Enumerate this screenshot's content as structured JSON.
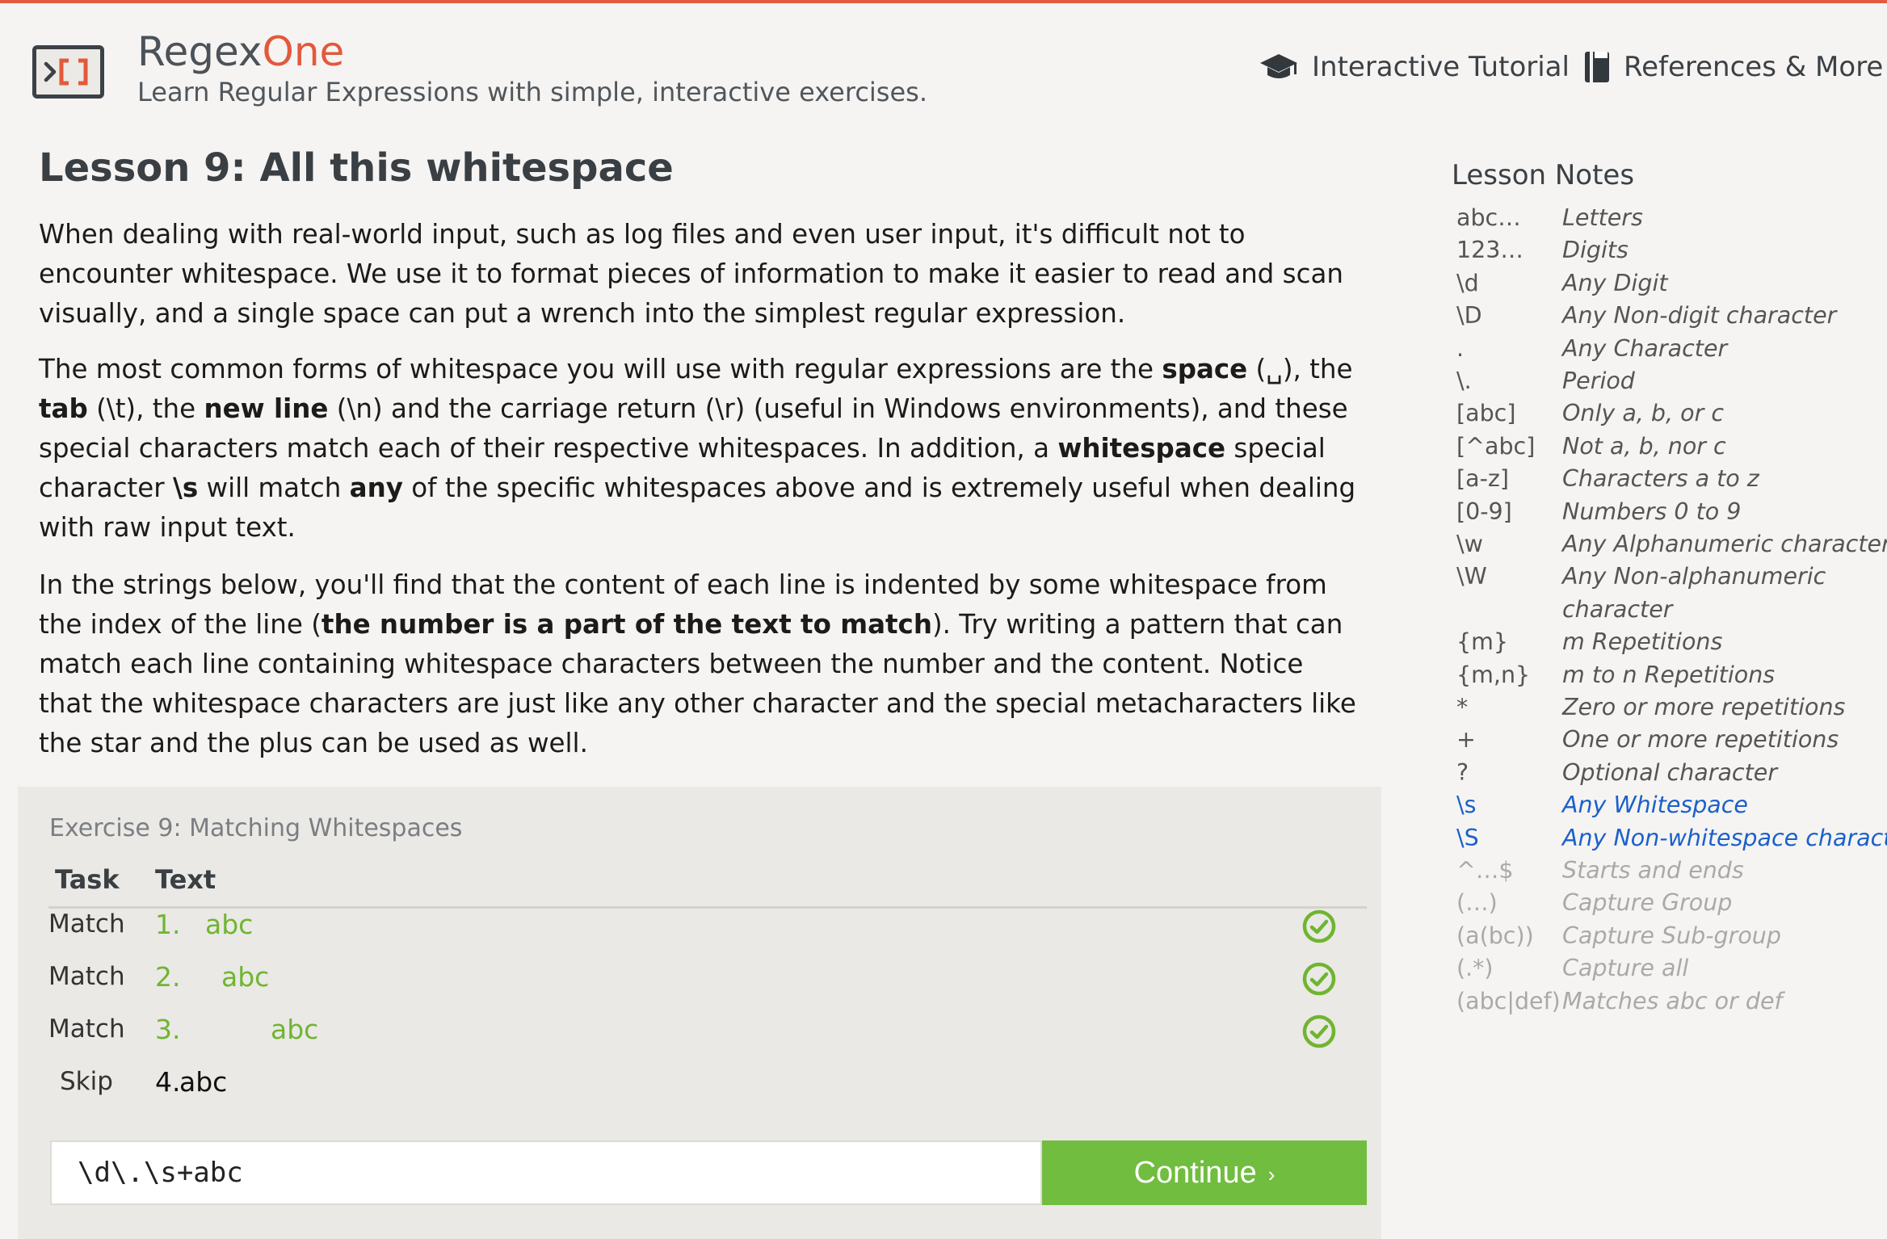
{
  "brand": {
    "name_start": "Regex",
    "name_accent": "One",
    "tagline": "Learn Regular Expressions with simple, interactive exercises."
  },
  "nav": [
    {
      "label": "Interactive Tutorial",
      "icon": "graduation-cap-icon"
    },
    {
      "label": "References & More",
      "icon": "book-icon"
    }
  ],
  "lesson": {
    "title": "Lesson 9: All this whitespace",
    "p1": "When dealing with real-world input, such as log files and even user input, it's difficult not to encounter whitespace. We use it to format pieces of information to make it easier to read and scan visually, and a single space can put a wrench into the simplest regular expression.",
    "p2": {
      "t1": "The most common forms of whitespace you will use with regular expressions are the ",
      "b1": "space",
      "t2": " (␣), the ",
      "b2": "tab",
      "t3": " (\\t), the ",
      "b3": "new line",
      "t4": " (\\n) and the carriage return (\\r) (useful in Windows environments), and these special characters match each of their respective whitespaces. In addition, a ",
      "b4": "whitespace",
      "t5": " special character ",
      "b5": "\\s",
      "t6": " will match ",
      "b6": "any",
      "t7": " of the specific whitespaces above and is extremely useful when dealing with raw input text."
    },
    "p3": {
      "t1": "In the strings below, you'll find that the content of each line is indented by some whitespace from the index of the line (",
      "b1": "the number is a part of the text to match",
      "t2": "). Try writing a pattern that can match each line containing whitespace characters between the number and the content. Notice that the whitespace characters are just like any other character and the special metacharacters like the star and the plus can be used as well."
    }
  },
  "exercise": {
    "title": "Exercise 9: Matching Whitespaces",
    "header_task": "Task",
    "header_text": "Text",
    "rows": [
      {
        "task": "Match",
        "num": "1.",
        "text": "abc",
        "matched": true
      },
      {
        "task": "Match",
        "num": "2.",
        "text": "abc",
        "matched": true
      },
      {
        "task": "Match",
        "num": "3.",
        "text": "abc",
        "matched": true
      },
      {
        "task": "Skip",
        "num": "4.",
        "text": "abc",
        "matched": false
      }
    ],
    "input_value": "\\d\\.\\s+abc",
    "continue_label": "Continue",
    "continue_chevron": "›"
  },
  "notes": {
    "title": "Lesson Notes",
    "items": [
      {
        "sym": "abc…",
        "desc": "Letters"
      },
      {
        "sym": "123…",
        "desc": "Digits"
      },
      {
        "sym": "\\d",
        "desc": "Any Digit"
      },
      {
        "sym": "\\D",
        "desc": "Any Non-digit character"
      },
      {
        "sym": ".",
        "desc": "Any Character"
      },
      {
        "sym": "\\.",
        "desc": "Period"
      },
      {
        "sym": "[abc]",
        "desc": "Only a, b, or c"
      },
      {
        "sym": "[^abc]",
        "desc": "Not a, b, nor c"
      },
      {
        "sym": "[a-z]",
        "desc": "Characters a to z"
      },
      {
        "sym": "[0-9]",
        "desc": "Numbers 0 to 9"
      },
      {
        "sym": "\\w",
        "desc": "Any Alphanumeric character"
      },
      {
        "sym": "\\W",
        "desc": "Any Non-alphanumeric"
      },
      {
        "sym": "",
        "desc": "character"
      },
      {
        "sym": "{m}",
        "desc": "m Repetitions"
      },
      {
        "sym": "{m,n}",
        "desc": "m to n Repetitions"
      },
      {
        "sym": "*",
        "desc": "Zero or more repetitions"
      },
      {
        "sym": "+",
        "desc": "One or more repetitions"
      },
      {
        "sym": "?",
        "desc": "Optional character"
      },
      {
        "sym": "\\s",
        "desc": "Any Whitespace",
        "highlight": true
      },
      {
        "sym": "\\S",
        "desc": "Any Non-whitespace character",
        "highlight": true
      },
      {
        "sym": "^…$",
        "desc": "Starts and ends",
        "dim": true
      },
      {
        "sym": "(…)",
        "desc": "Capture Group",
        "dim": true
      },
      {
        "sym": "(a(bc))",
        "desc": "Capture Sub-group",
        "dim": true
      },
      {
        "sym": "(.*)",
        "desc": "Capture all",
        "dim": true
      },
      {
        "sym": "(abc|def)",
        "desc": "Matches abc or def",
        "dim": true
      }
    ]
  },
  "colors": {
    "accent": "#e2593b",
    "match_green": "#6fb531",
    "button_green": "#71bd3f",
    "note_highlight": "#1b60c9",
    "note_dim": "#a9a9a9"
  }
}
